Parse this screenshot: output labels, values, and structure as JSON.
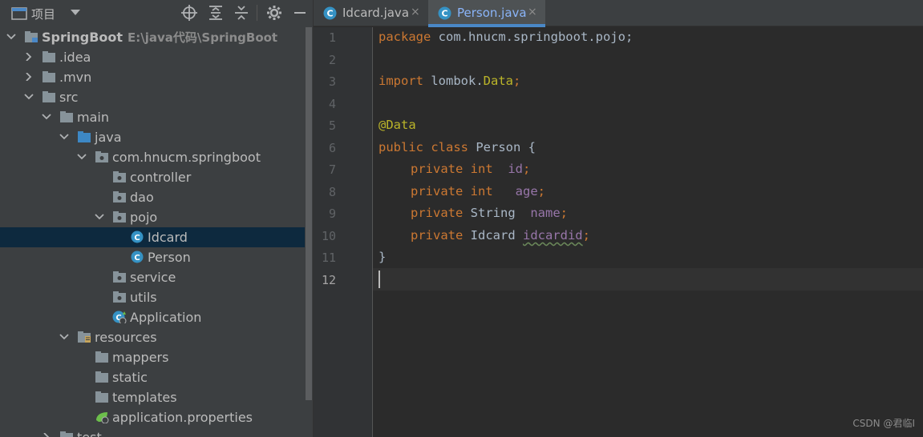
{
  "project_panel": {
    "title": "项目",
    "tools": [
      "locate-icon",
      "expand-all-icon",
      "collapse-all-icon",
      "gear-icon",
      "minimize-icon"
    ]
  },
  "tree": [
    {
      "label": "SpringBoot",
      "path": "E:\\java代码\\SpringBoot",
      "icon": "module-folder-icon",
      "expanded": true,
      "depth": 0
    },
    {
      "label": ".idea",
      "icon": "folder-icon",
      "expanded": false,
      "depth": 1
    },
    {
      "label": ".mvn",
      "icon": "folder-icon",
      "expanded": false,
      "depth": 1
    },
    {
      "label": "src",
      "icon": "folder-icon",
      "expanded": true,
      "depth": 1
    },
    {
      "label": "main",
      "icon": "folder-icon",
      "expanded": true,
      "depth": 2
    },
    {
      "label": "java",
      "icon": "source-folder-icon",
      "expanded": true,
      "depth": 3
    },
    {
      "label": "com.hnucm.springboot",
      "icon": "package-icon",
      "expanded": true,
      "depth": 4
    },
    {
      "label": "controller",
      "icon": "package-icon",
      "depth": 5
    },
    {
      "label": "dao",
      "icon": "package-icon",
      "depth": 5
    },
    {
      "label": "pojo",
      "icon": "package-icon",
      "expanded": true,
      "depth": 5
    },
    {
      "label": "Idcard",
      "icon": "class-icon",
      "depth": 6,
      "selected": true
    },
    {
      "label": "Person",
      "icon": "class-icon",
      "depth": 6
    },
    {
      "label": "service",
      "icon": "package-icon",
      "depth": 5
    },
    {
      "label": "utils",
      "icon": "package-icon",
      "depth": 5
    },
    {
      "label": "Application",
      "icon": "spring-app-icon",
      "depth": 5
    },
    {
      "label": "resources",
      "icon": "resources-folder-icon",
      "expanded": true,
      "depth": 3
    },
    {
      "label": "mappers",
      "icon": "folder-icon",
      "depth": 4
    },
    {
      "label": "static",
      "icon": "folder-icon",
      "depth": 4
    },
    {
      "label": "templates",
      "icon": "folder-icon",
      "depth": 4
    },
    {
      "label": "application.properties",
      "icon": "spring-properties-icon",
      "depth": 4
    },
    {
      "label": "test",
      "icon": "folder-icon",
      "expanded": false,
      "depth": 2
    }
  ],
  "tabs": [
    {
      "label": "Idcard.java",
      "close": "×",
      "active": false
    },
    {
      "label": "Person.java",
      "close": "×",
      "active": true
    }
  ],
  "editor": {
    "line_numbers": [
      "1",
      "2",
      "3",
      "4",
      "5",
      "6",
      "7",
      "8",
      "9",
      "10",
      "11",
      "12"
    ],
    "current_line": "12",
    "lines": {
      "l1": {
        "kw": "package",
        "rest": " com.hnucm.springboot.pojo;"
      },
      "l3": {
        "kw": "import",
        "rest": " lombok.",
        "cls": "Data",
        "end": ";"
      },
      "l5": {
        "ann": "@Data"
      },
      "l6": {
        "kw1": "public",
        "kw2": "class",
        "rest": " Person {"
      },
      "l7": {
        "kw1": "private",
        "kw2": "int",
        "field": "id",
        "end": ";"
      },
      "l8": {
        "kw1": "private",
        "kw2": "int",
        "field": "age",
        "end": ";"
      },
      "l9": {
        "kw1": "private",
        "type": " String ",
        "field": "name",
        "end": ";"
      },
      "l10": {
        "kw1": "private",
        "type": " Idcard ",
        "field": "idcardid",
        "end": ";"
      },
      "l11": {
        "rest": "}"
      }
    }
  },
  "watermark": "CSDN @君临I",
  "colors": {
    "keyword": "#cc7832",
    "annotation": "#bbb529",
    "field": "#9876aa",
    "selection": "#0d293e",
    "tab_accent": "#4a88c7"
  }
}
